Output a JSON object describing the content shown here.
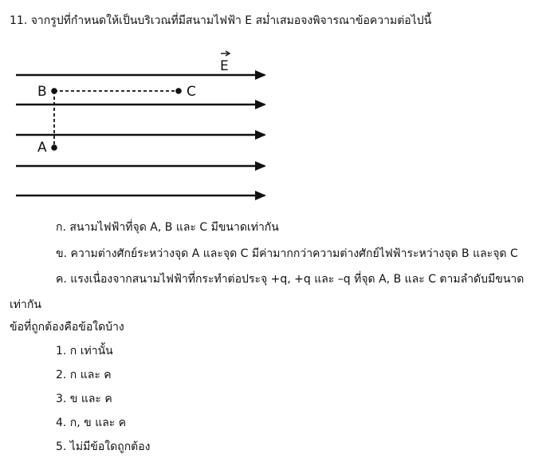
{
  "question": {
    "title": "11. จากรูปที่กำหนดให้เป็นบริเวณที่มีสนามไฟฟ้า E สม่ำเสมอจงพิจารณาข้อความต่อไปนี้"
  },
  "figure": {
    "field_label": "E",
    "points": {
      "A": "A",
      "B": "B",
      "C": "C"
    }
  },
  "statements": [
    "ก. สนามไฟฟ้าที่จุด A, B และ C มีขนาดเท่ากัน",
    "ข. ความต่างศักย์ระหว่างจุด A และจุด C มีค่ามากกว่าความต่างศักย์ไฟฟ้าระหว่างจุด B และจุด C",
    "ค. แรงเนื่องจากสนามไฟฟ้าที่กระทำต่อประจุ +q, +q และ –q ที่จุด A, B และ C ตามลำดับมีขนาด",
    "เท่ากัน"
  ],
  "prompt": "ข้อที่ถูกต้องคือข้อใดบ้าง",
  "options": [
    "1. ก เท่านั้น",
    "2. ก และ ค",
    "3. ข และ ค",
    "4. ก, ข และ ค",
    "5. ไม่มีข้อใดถูกต้อง"
  ]
}
